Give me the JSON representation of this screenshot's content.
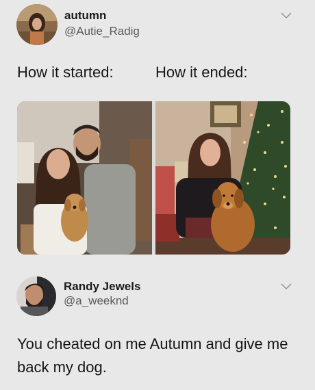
{
  "tweet1": {
    "display_name": "autumn",
    "handle": "@Autie_Radig",
    "caption_left": "How it started:",
    "caption_right": "How it ended:",
    "icons": {
      "menu": "chevron-down-icon",
      "avatar": "profile-photo"
    }
  },
  "tweet2": {
    "display_name": "Randy Jewels",
    "handle": "@a_weeknd",
    "text": "You cheated on me Autumn and give me back my dog.",
    "icons": {
      "menu": "chevron-down-icon",
      "avatar": "profile-photo"
    }
  },
  "colors": {
    "background": "#e9e8e9",
    "text": "#141414",
    "handle": "#5b5b5b"
  }
}
